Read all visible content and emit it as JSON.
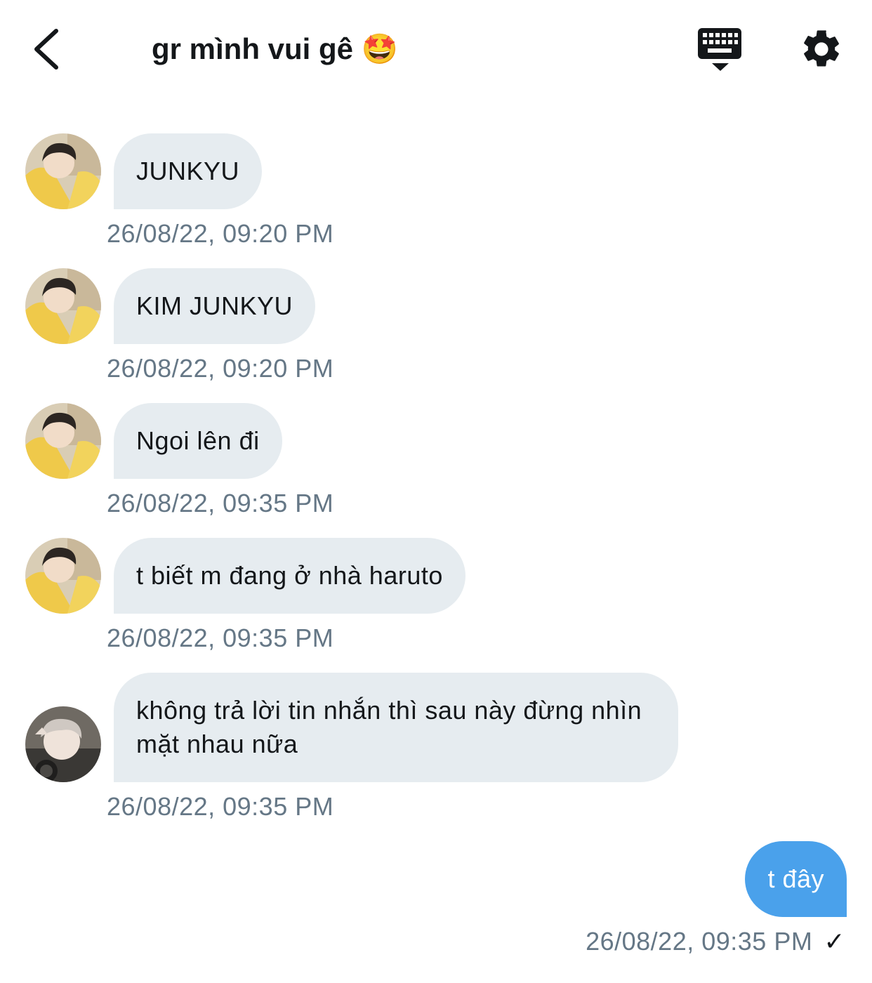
{
  "header": {
    "title": "gr mình vui gê 🤩",
    "back_icon": "chevron-left-icon",
    "keyboard_icon": "keyboard-icon",
    "settings_icon": "gear-icon"
  },
  "messages": [
    {
      "text": "JUNKYU",
      "time": "26/08/22, 09:20 PM",
      "sender": "other-1"
    },
    {
      "text": "KIM JUNKYU",
      "time": "26/08/22, 09:20 PM",
      "sender": "other-1"
    },
    {
      "text": "Ngoi lên đi",
      "time": "26/08/22, 09:35 PM",
      "sender": "other-1"
    },
    {
      "text": "t biết m đang ở nhà haruto",
      "time": "26/08/22, 09:35 PM",
      "sender": "other-1"
    },
    {
      "text": "không trả lời tin nhắn thì sau này đừng nhìn mặt nhau nữa",
      "time": "26/08/22, 09:35 PM",
      "sender": "other-2"
    },
    {
      "text": "t đây",
      "time": "26/08/22, 09:35 PM",
      "sender": "me",
      "status": "✓"
    }
  ],
  "colors": {
    "received_bubble": "#e6ecf0",
    "sent_bubble": "#4aa1eb",
    "timestamp": "#657786",
    "text": "#14171a"
  }
}
